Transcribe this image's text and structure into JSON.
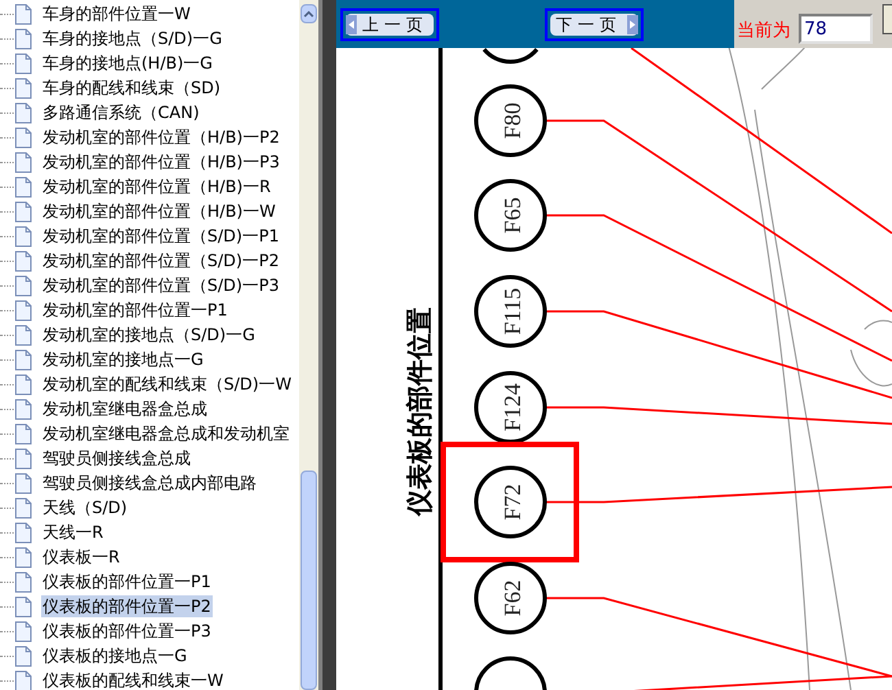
{
  "tree": {
    "items": [
      {
        "label": "车身的部件位置一W",
        "selected": false
      },
      {
        "label": "车身的接地点（S/D)一G",
        "selected": false
      },
      {
        "label": "车身的接地点(H/B)一G",
        "selected": false
      },
      {
        "label": "车身的配线和线束（SD)",
        "selected": false
      },
      {
        "label": "多路通信系统（CAN)",
        "selected": false
      },
      {
        "label": "发动机室的部件位置（H/B)一P2",
        "selected": false
      },
      {
        "label": "发动机室的部件位置（H/B)一P3",
        "selected": false
      },
      {
        "label": "发动机室的部件位置（H/B)一R",
        "selected": false
      },
      {
        "label": "发动机室的部件位置（H/B)一W",
        "selected": false
      },
      {
        "label": "发动机室的部件位置（S/D)一P1",
        "selected": false
      },
      {
        "label": "发动机室的部件位置（S/D)一P2",
        "selected": false
      },
      {
        "label": "发动机室的部件位置（S/D)一P3",
        "selected": false
      },
      {
        "label": "发动机室的部件位置一P1",
        "selected": false
      },
      {
        "label": "发动机室的接地点（S/D)一G",
        "selected": false
      },
      {
        "label": "发动机室的接地点一G",
        "selected": false
      },
      {
        "label": "发动机室的配线和线束（S/D)一W",
        "selected": false
      },
      {
        "label": "发动机室继电器盒总成",
        "selected": false
      },
      {
        "label": "发动机室继电器盒总成和发动机室",
        "selected": false
      },
      {
        "label": "驾驶员侧接线盒总成",
        "selected": false
      },
      {
        "label": "驾驶员侧接线盒总成内部电路",
        "selected": false
      },
      {
        "label": "天线（S/D)",
        "selected": false
      },
      {
        "label": "天线一R",
        "selected": false
      },
      {
        "label": "仪表板一R",
        "selected": false
      },
      {
        "label": "仪表板的部件位置一P1",
        "selected": false
      },
      {
        "label": "仪表板的部件位置一P2",
        "selected": true
      },
      {
        "label": "仪表板的部件位置一P3",
        "selected": false
      },
      {
        "label": "仪表板的接地点一G",
        "selected": false
      },
      {
        "label": "仪表板的配线和线束一W",
        "selected": false
      }
    ]
  },
  "toolbar": {
    "buttons": [
      {
        "label": "上一页",
        "kind": "prev"
      },
      {
        "label": "下一页",
        "kind": "next"
      }
    ],
    "page_label": "当前为",
    "page_field": {
      "value": "78"
    }
  },
  "diagram": {
    "title": "仪表板的部件位置",
    "connectors": [
      {
        "highlighted": false
      },
      {
        "label": "F80",
        "highlighted": false
      },
      {
        "label": "F65",
        "highlighted": false
      },
      {
        "label": "F115",
        "highlighted": false
      },
      {
        "label": "F124",
        "highlighted": false
      },
      {
        "label": "F72",
        "highlighted": true
      },
      {
        "label": "F62",
        "highlighted": false
      },
      {
        "highlighted": false
      }
    ]
  }
}
